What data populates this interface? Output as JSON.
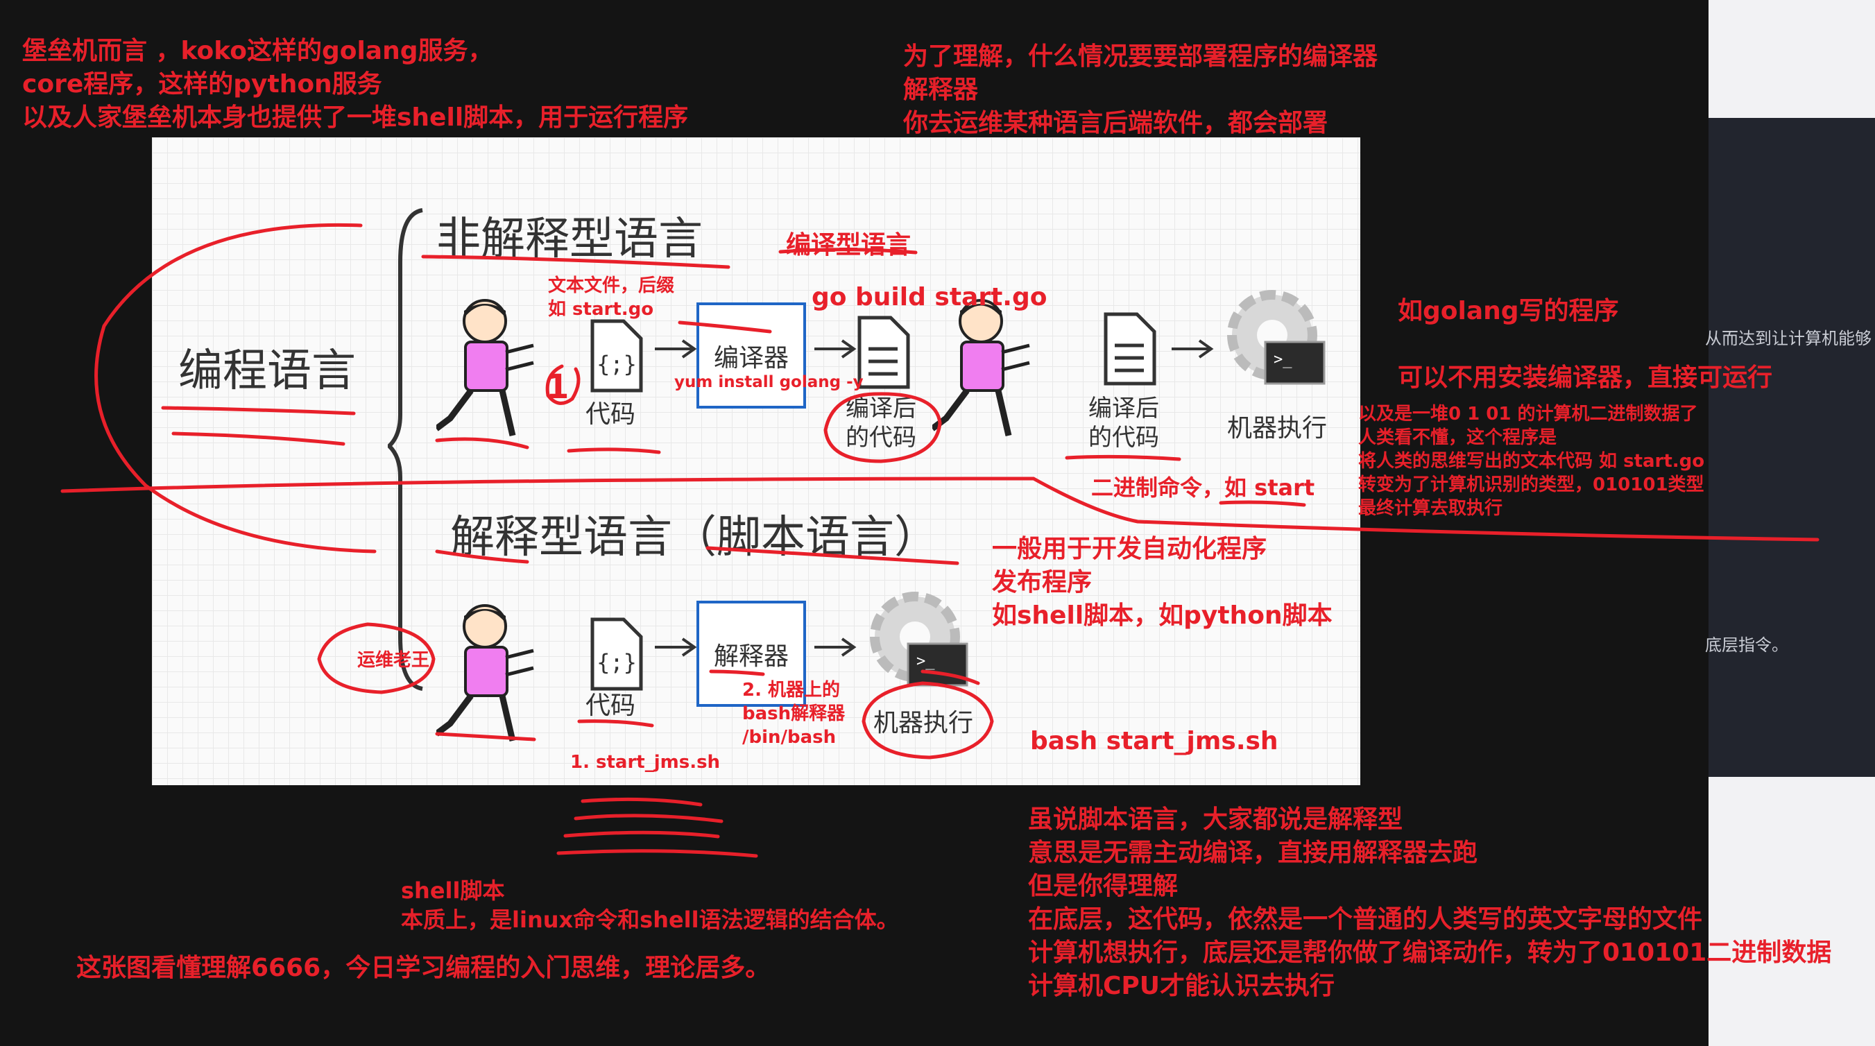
{
  "annotations": {
    "top_left": [
      "堡垒机而言 ，koko这样的golang服务，",
      "core程序，这样的python服务",
      "以及人家堡垒机本身也提供了一堆shell脚本，用于运行程序"
    ],
    "top_center": [
      "为了理解，什么情况要要部署程序的编译器",
      "解释器",
      "你去运维某种语言后端软件，都会部署"
    ],
    "compiled_lang": "编译型语言",
    "text_file": [
      "文本文件，后缀",
      "如   start.go"
    ],
    "go_build": "go build start.go",
    "yum_install": "yum install golang -y",
    "binary_cmd": "二进制命令，如 start",
    "golang_note": [
      "如golang写的程序",
      "",
      "可以不用安装编译器，直接可运行"
    ],
    "binary_explain": [
      "以及是一堆0 1 01 的计算机二进制数据了",
      "人类看不懂，这个程序是",
      "将人类的思维写出的文本代码 如 start.go",
      "转变为了计算机识别的类型，010101类型",
      "最终计算去取执行"
    ],
    "automation": [
      "一般用于开发自动化程序",
      "发布程序",
      "如shell脚本，如python脚本"
    ],
    "ops_wang": "运维老王",
    "machine_bash": [
      "2. 机器上的",
      "bash解释器",
      "/bin/bash"
    ],
    "start_jms": "1.    start_jms.sh",
    "bash_cmd": "bash  start_jms.sh",
    "script_note": [
      "虽说脚本语言，大家都说是解释型",
      "意思是无需主动编译，直接用解释器去跑",
      "但是你得理解",
      "在底层，这代码，依然是一个普通的人类写的英文字母的文件",
      "计算机想执行，底层还是帮你做了编译动作，转为了010101二进制数据",
      "计算机CPU才能认识去执行"
    ],
    "shell_note": [
      "shell脚本",
      "本质上，是linux命令和shell语法逻辑的结合体。"
    ],
    "bottom_note": "这张图看懂理解6666，今日学习编程的入门思维，理论居多。"
  },
  "diagram": {
    "root": "编程语言",
    "non_interpreted": "非解释型语言",
    "interpreted": "解释型语言（脚本语言）",
    "code": "代码",
    "compiler": "编译器",
    "compiled_code": [
      "编译后",
      "的代码"
    ],
    "machine_exec": "机器执行",
    "interpreter": "解释器"
  },
  "right_panel": {
    "text1": "从而达到让计算机能够",
    "text2": "底层指令。"
  },
  "colors": {
    "annotation": "#e8202a",
    "box_border": "#1f66c6",
    "person": "#f07ef0"
  }
}
